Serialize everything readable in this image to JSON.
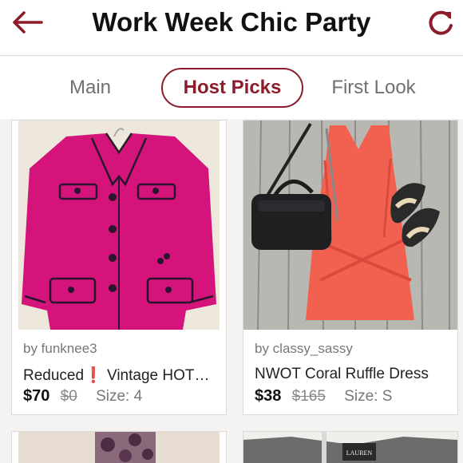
{
  "header": {
    "title": "Work Week Chic Party",
    "back_icon": "back-arrow-icon",
    "refresh_icon": "refresh-icon",
    "accent": "#8c1c2a"
  },
  "tabs": [
    {
      "label": "Main",
      "active": false
    },
    {
      "label": "Host Picks",
      "active": true
    },
    {
      "label": "First Look",
      "active": false
    }
  ],
  "listings": [
    {
      "by": "by funknee3",
      "title": "Reduced❗ Vintage HOT…",
      "price": "$70",
      "original_price": "$0",
      "size": "Size: 4",
      "photo": "pink blazer with navy trim"
    },
    {
      "by": "by classy_sassy",
      "title": "NWOT Coral Ruffle Dress",
      "price": "$38",
      "original_price": "$165",
      "size": "Size: S",
      "photo": "coral ruffle dress with black handbag and leopard flats"
    }
  ],
  "partial_listings": [
    {
      "photo": "purple floral fabric"
    },
    {
      "photo": "grey dress with Lauren label",
      "label_text": "LAUREN"
    }
  ]
}
